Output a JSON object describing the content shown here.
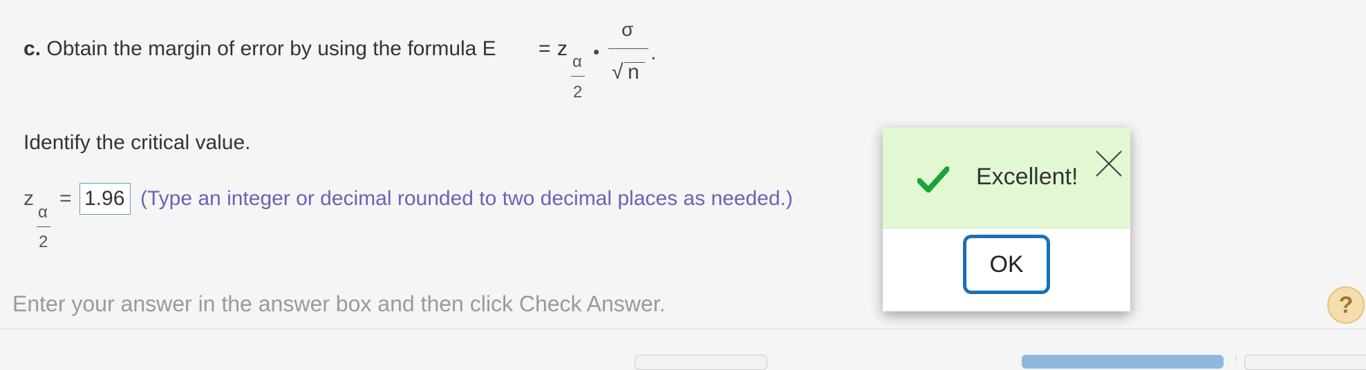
{
  "question": {
    "part_label": "c.",
    "text": "Obtain the margin of error by using the formula E",
    "equals": "=",
    "z": "z",
    "alpha": "α",
    "two": "2",
    "dot": "•",
    "sigma": "σ",
    "radical": "√",
    "n": "n",
    "period": "."
  },
  "identify": "Identify the critical value.",
  "answer": {
    "z": "z",
    "alpha": "α",
    "two": "2",
    "equals": "=",
    "value": "1.96",
    "hint": "(Type an integer or decimal rounded to two decimal places as needed.)"
  },
  "instruction": "Enter your answer in the answer box and then click Check Answer.",
  "help_label": "?",
  "popup": {
    "message": "Excellent!",
    "ok_label": "OK",
    "check_color": "#1aa33a",
    "icons": [
      "checkmark-icon",
      "close-icon"
    ]
  },
  "colors": {
    "hint": "#6b62b4",
    "popup_header": "#e2f8d3",
    "ok_border": "#1a6fb8",
    "input_border": "#5a9ec2"
  }
}
